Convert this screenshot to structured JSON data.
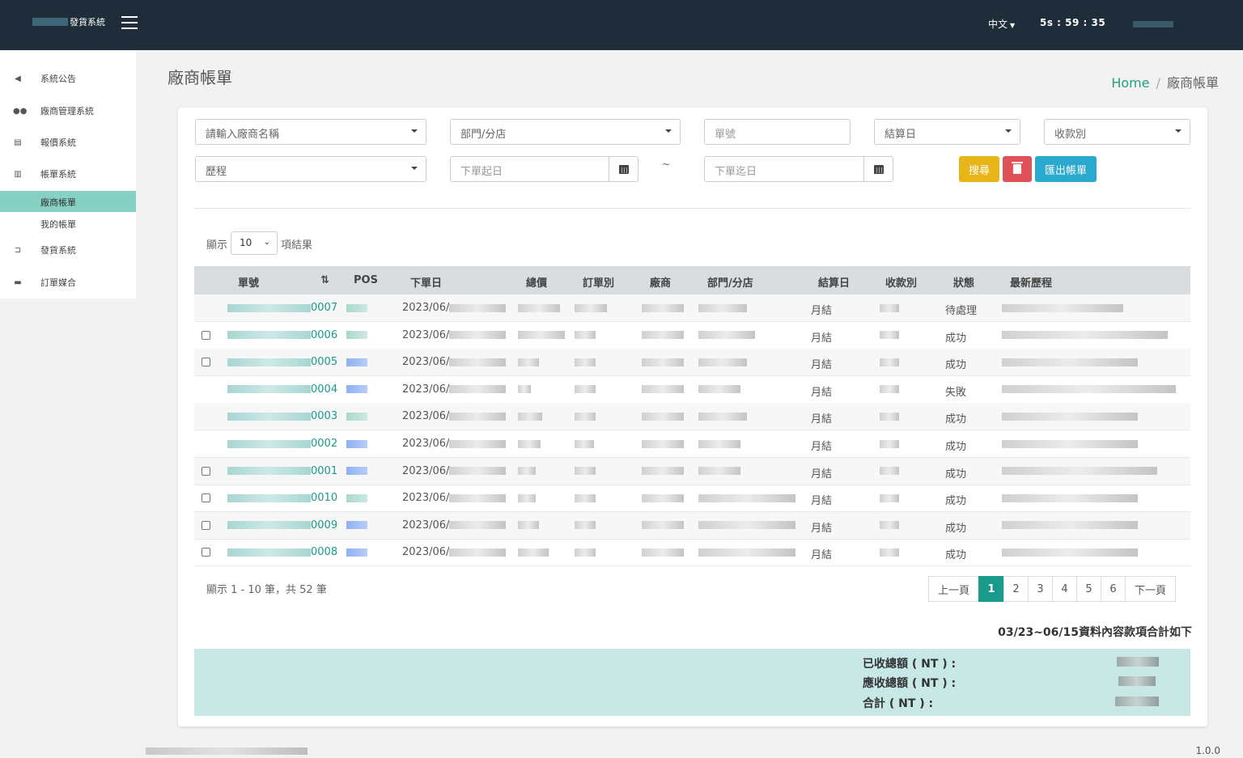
{
  "header": {
    "app_title": "發貨系統",
    "lang": "中文",
    "timer": "5s : 59 : 35"
  },
  "sidebar": {
    "items": [
      {
        "label": "系統公告",
        "icon": "megaphone-icon"
      },
      {
        "label": "廠商管理系統",
        "icon": "users-icon"
      },
      {
        "label": "報價系統",
        "icon": "document-icon"
      },
      {
        "label": "帳單系統",
        "icon": "bill-icon"
      },
      {
        "label": "發貨系統",
        "icon": "cart-icon"
      },
      {
        "label": "訂單媒合",
        "icon": "card-icon"
      }
    ],
    "sub_items": [
      {
        "label": "廠商帳單",
        "active": true
      },
      {
        "label": "我的帳單",
        "active": false
      }
    ]
  },
  "page": {
    "title": "廠商帳單",
    "breadcrumb_home": "Home",
    "breadcrumb_sep": "/",
    "breadcrumb_current": "廠商帳單"
  },
  "filters": {
    "vendor_placeholder": "請輸入廠商名稱",
    "department_placeholder": "部門/分店",
    "order_no_placeholder": "單號",
    "settle_day_placeholder": "結算日",
    "payment_type_placeholder": "收款別",
    "history_placeholder": "歷程",
    "date_from_placeholder": "下單起日",
    "date_sep": "~",
    "date_to_placeholder": "下單迄日",
    "search_label": "搜尋",
    "export_label": "匯出帳單"
  },
  "length": {
    "prefix": "顯示",
    "value": "10",
    "suffix": "項結果"
  },
  "table": {
    "columns": [
      "單號",
      "POS",
      "下單日",
      "總價",
      "訂單別",
      "廠商",
      "部門/分店",
      "結算日",
      "收款別",
      "狀態",
      "最新歷程"
    ],
    "rows": [
      {
        "order_suffix": "0007",
        "date": "2023/06/",
        "settle": "月結",
        "status": "待處理",
        "checkbox": false
      },
      {
        "order_suffix": "0006",
        "date": "2023/06/",
        "settle": "月結",
        "status": "成功",
        "checkbox": true
      },
      {
        "order_suffix": "0005",
        "date": "2023/06/",
        "settle": "月結",
        "status": "成功",
        "checkbox": true
      },
      {
        "order_suffix": "0004",
        "date": "2023/06/",
        "settle": "月結",
        "status": "失敗",
        "checkbox": false
      },
      {
        "order_suffix": "0003",
        "date": "2023/06/",
        "settle": "月結",
        "status": "成功",
        "checkbox": false
      },
      {
        "order_suffix": "0002",
        "date": "2023/06/",
        "settle": "月結",
        "status": "成功",
        "checkbox": false
      },
      {
        "order_suffix": "0001",
        "date": "2023/06/",
        "settle": "月結",
        "status": "成功",
        "checkbox": true
      },
      {
        "order_suffix": "0010",
        "date": "2023/06/",
        "settle": "月結",
        "status": "成功",
        "checkbox": true
      },
      {
        "order_suffix": "0009",
        "date": "2023/06/",
        "settle": "月結",
        "status": "成功",
        "checkbox": true
      },
      {
        "order_suffix": "0008",
        "date": "2023/06/",
        "settle": "月結",
        "status": "成功",
        "checkbox": true
      }
    ]
  },
  "pagination": {
    "info": "顯示 1 - 10 筆，共 52 筆",
    "prev": "上一頁",
    "pages": [
      "1",
      "2",
      "3",
      "4",
      "5",
      "6"
    ],
    "current": "1",
    "next": "下一頁"
  },
  "summary": {
    "title": "03/23~06/15資料內容款項合計如下",
    "received_label": "已收總額 ( NT ) :",
    "receivable_label": "應收總額 ( NT ) :",
    "total_label": "合計 ( NT ) :"
  },
  "footer": {
    "version": "1.0.0"
  },
  "colors": {
    "topbar": "#1f2d3a",
    "accent": "#1a9a8a",
    "active_nav": "#86d0c4",
    "search_button": "#e8b519",
    "delete_button": "#e0525a",
    "export_button": "#2aa9cf",
    "summary_bg": "#c7e8e4"
  }
}
